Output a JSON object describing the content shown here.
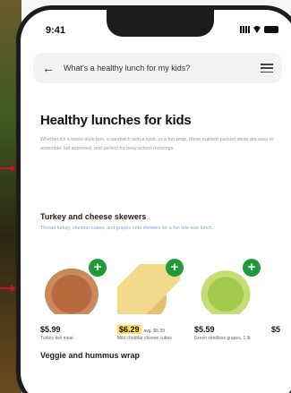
{
  "status": {
    "time": "9:41"
  },
  "search": {
    "query": "What's a healthy lunch for my kids?"
  },
  "page": {
    "title": "Healthy lunches for kids",
    "intro": "Whether it's a bento-style box, a sandwich with a twist, or a fun wrap, these nutrient-packed ideas are easy to assemble, kid approved, and perfect for busy school mornings."
  },
  "sections": [
    {
      "title": "Turkey and cheese skewers",
      "subtitle": "Thread turkey, cheddar cubes, and grapes onto skewers for a fun bite-size lunch."
    },
    {
      "title": "Veggie and hummus wrap"
    }
  ],
  "products": [
    {
      "price": "$5.99",
      "unit": "",
      "desc": "Turkey deli meat",
      "highlight": false
    },
    {
      "price": "$6.29",
      "unit": "avg. $6.39",
      "desc": "Mild cheddar cheese cubes",
      "highlight": true
    },
    {
      "price": "$5.59",
      "unit": "",
      "desc": "Green seedless grapes, 1 lb",
      "highlight": false
    },
    {
      "price": "$5",
      "unit": "",
      "desc": "",
      "highlight": false
    }
  ],
  "colors": {
    "accent": "#1f9b3a",
    "sale_highlight": "#ffe14d",
    "callout": "#c8102e"
  },
  "icons": [
    "back-arrow-icon",
    "filter-icon",
    "add-icon"
  ]
}
